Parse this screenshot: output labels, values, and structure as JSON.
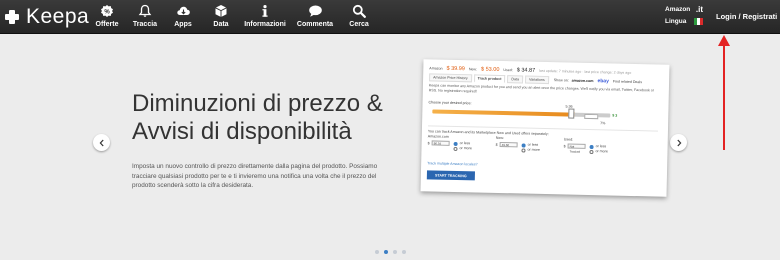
{
  "brand": {
    "name": "Keepa"
  },
  "nav": {
    "items": [
      {
        "key": "offers",
        "label": "Offerte",
        "icon": "offers-icon"
      },
      {
        "key": "tracking",
        "label": "Traccia",
        "icon": "bell-icon"
      },
      {
        "key": "apps",
        "label": "Apps",
        "icon": "download-cloud-icon"
      },
      {
        "key": "data",
        "label": "Data",
        "icon": "box-icon"
      },
      {
        "key": "info",
        "label": "Informazioni",
        "icon": "info-icon"
      },
      {
        "key": "comments",
        "label": "Commenta",
        "icon": "chat-icon"
      },
      {
        "key": "search",
        "label": "Cerca",
        "icon": "search-icon"
      }
    ],
    "region": {
      "store_label": "Amazon",
      "tld": ".it",
      "language_label": "Lingua"
    },
    "login_label": "Login / Registrati"
  },
  "hero": {
    "title": "Diminuzioni di prezzo & Avvisi di disponibilità",
    "text": "Imposta un nuovo controllo di prezzo direttamente dalla pagina del prodotto. Possiamo tracciare qualsiasi prodotto per te e ti invieremo una notifica una volta che il prezzo del prodotto scenderà sotto la cifra desiderata."
  },
  "carousel": {
    "slides": 4,
    "active_index": 1
  },
  "preview": {
    "top_amazon_label": "Amazon",
    "top_amazon_price": "$ 39.99",
    "top_new_label": "New:",
    "top_new_price": "$ 53.00",
    "top_used_label": "Used:",
    "top_used_price": "$ 34.87",
    "top_note": "last update: 7 minutes ago · last price change: 2 days ago",
    "tab_history": "Amazon Price History",
    "tab_track": "Track product",
    "tab_data": "Data",
    "tab_variations": "Variations",
    "show_on": "Show on:",
    "amazon_logo": "amazon.com",
    "ebay_logo": "ebay",
    "find_deals": "Find related Deals",
    "intro_text": "Keepa can monitor any Amazon product for you and send you an alert once the price changes. We'll notify you via email, Twitter, Facebook or RSS. No registration required!",
    "choose_price": "Choose your desired price:",
    "slider_fill": 0.8,
    "slider_value1": "5.36",
    "slider_value2": "7%",
    "slider_price": "$ 3",
    "subtext": "You can track Amazon and its Marketplace New and Used offers separately:",
    "col1_name": "Amazon.com",
    "col1_value": "96.34",
    "col2_name": "New:",
    "col2_value": "49.60",
    "col3_name": "Used:",
    "col3_value": "Not Tracked",
    "radio_less": "or less",
    "radio_more": "or more",
    "multi_link": "Track multiple Amazon locales?",
    "track_button": "START TRACKING"
  },
  "colors": {
    "navbar": "#2e2e2e",
    "arrow": "#e32222",
    "accent": "#2b66b0",
    "price_red": "#e05a0c",
    "background": "#ececec"
  }
}
